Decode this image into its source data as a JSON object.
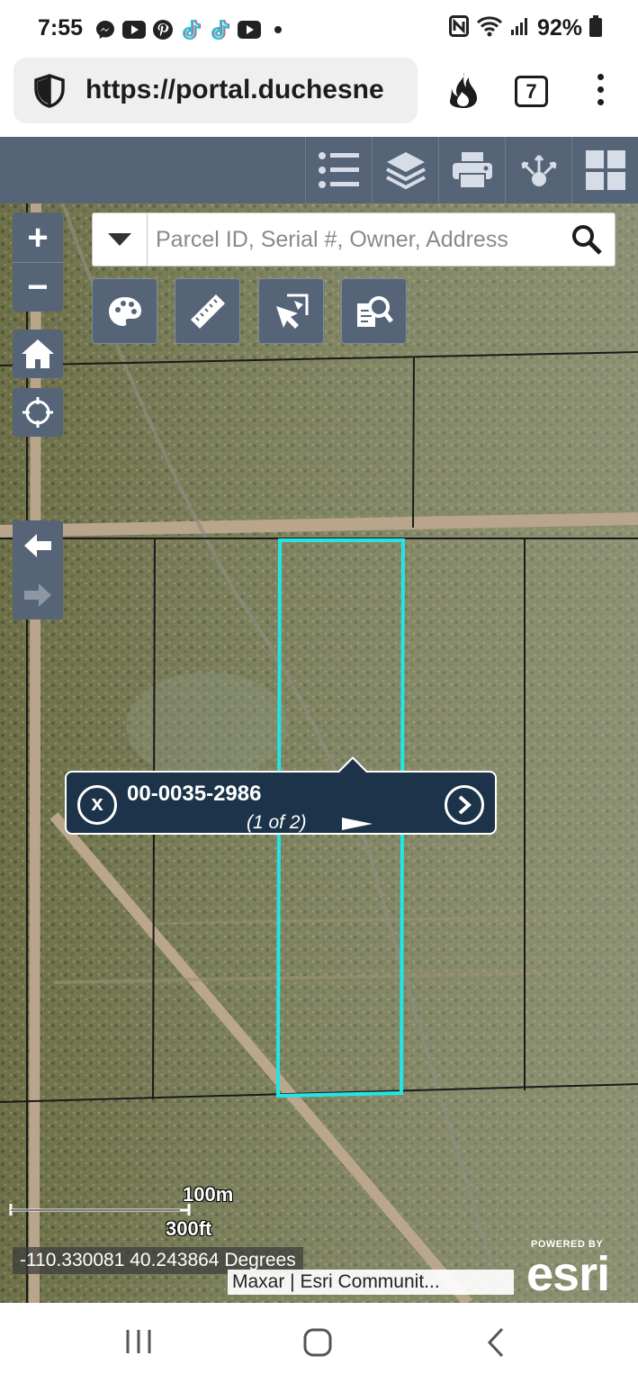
{
  "status_bar": {
    "time": "7:55",
    "battery": "92%",
    "left_icons": [
      "messenger-icon",
      "youtube-icon",
      "pinterest-icon",
      "tiktok-icon",
      "tiktok-icon",
      "youtube-icon",
      "dot-icon"
    ],
    "right_icons": [
      "nfc-icon",
      "wifi-icon",
      "signal-icon",
      "battery-icon"
    ]
  },
  "browser": {
    "url": "https://portal.duchesne",
    "tab_count": "7"
  },
  "toolbar": {
    "icons": [
      "list-icon",
      "layers-icon",
      "print-icon",
      "share-icon",
      "grid-icon"
    ]
  },
  "map": {
    "search": {
      "placeholder": "Parcel ID, Serial #, Owner, Address"
    },
    "zoom_in_label": "+",
    "zoom_out_label": "−",
    "tools": [
      "palette-icon",
      "ruler-icon",
      "select-icon",
      "find-icon"
    ],
    "popup": {
      "title": "00-0035-2986",
      "count": "(1 of 2)",
      "close_label": "x"
    },
    "scale": {
      "metric": "100m",
      "imperial": "300ft"
    },
    "coordinates": "-110.330081 40.243864 Degrees",
    "attribution": "Maxar | Esri Communit...",
    "esri": {
      "powered_by": "POWERED BY",
      "logo": "esri"
    }
  },
  "colors": {
    "toolbar": "#566478",
    "popup": "#1c3349",
    "parcel_outline": "#21e6e6"
  }
}
